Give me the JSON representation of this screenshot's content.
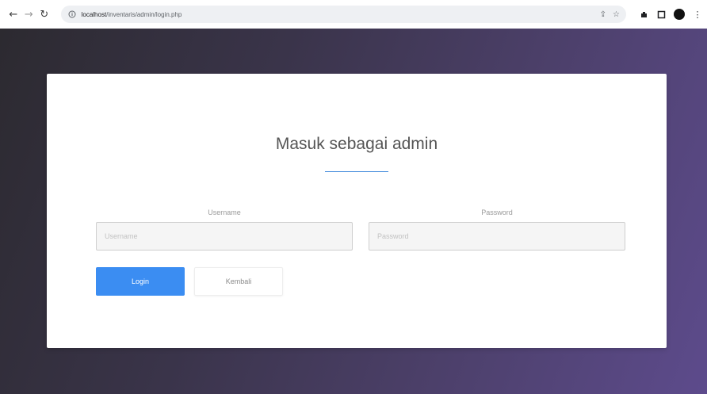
{
  "browser": {
    "back_icon": "back-arrow-icon",
    "forward_icon": "forward-arrow-icon",
    "reload_icon": "reload-icon",
    "url_host": "localhost",
    "url_path": "/inventaris/admin/login.php"
  },
  "login": {
    "title": "Masuk sebagai admin",
    "username_label": "Username",
    "username_placeholder": "Username",
    "password_label": "Password",
    "password_placeholder": "Password",
    "login_button": "Login",
    "back_button": "Kembali"
  },
  "colors": {
    "accent": "#3b8df2",
    "underline": "#4a8fde",
    "background_start": "#2c2a30",
    "background_end": "#5d4b8c"
  }
}
